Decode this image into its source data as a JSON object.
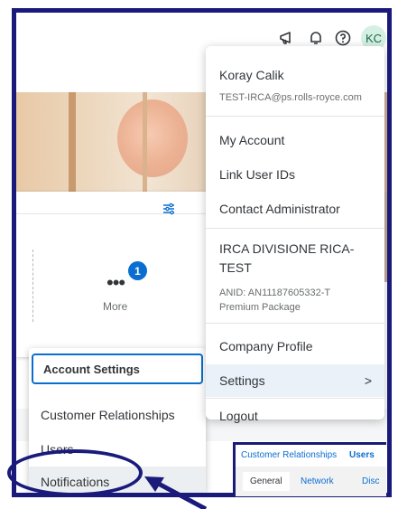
{
  "header": {
    "avatar_initials": "KC",
    "icons": [
      "megaphone-icon",
      "bell-icon",
      "help-icon"
    ]
  },
  "tile": {
    "more_label": "More",
    "badge_count": "1"
  },
  "user_menu": {
    "name": "Koray Calik",
    "email": "TEST-IRCA@ps.rolls-royce.com",
    "my_account": "My Account",
    "link_user_ids": "Link User IDs",
    "contact_admin": "Contact Administrator",
    "company_name": "IRCA DIVISIONE RICA-TEST",
    "anid": "ANID: AN11187605332-T",
    "package": "Premium Package",
    "company_profile": "Company Profile",
    "settings": "Settings",
    "settings_chevron": ">",
    "logout": "Logout"
  },
  "settings_submenu": {
    "items": [
      "Account Settings",
      "Customer Relationships",
      "Users",
      "Notifications"
    ]
  },
  "preview": {
    "top_tabs": [
      "Customer Relationships",
      "Users"
    ],
    "sub_tabs": [
      "General",
      "Network",
      "Disc"
    ]
  },
  "colors": {
    "annotation": "#1a1a7a",
    "accent": "#0a6ed1",
    "avatar_bg": "#d5f0e3"
  }
}
